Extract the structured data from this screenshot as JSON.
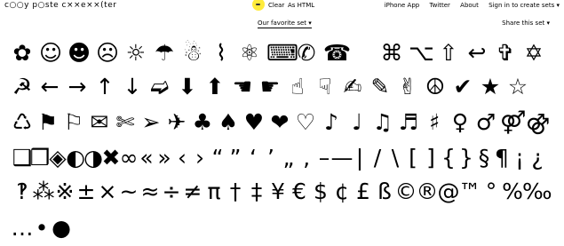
{
  "topbar": {
    "logo_text": "c○○y  p○ste c××e××(ter",
    "clear_label": "Clear",
    "as_html_label": "As HTML",
    "nav": [
      "iPhone App",
      "Twitter",
      "About",
      "Sign in to create sets ▾"
    ]
  },
  "setbar": {
    "favorite_set_label": "Our favorite set ▾",
    "share_label": "Share this set ▾"
  },
  "glyph_rows": [
    [
      "✿",
      "☺",
      "☻",
      "☹",
      "☼",
      "☂",
      "☃",
      "⌇",
      "⚛",
      "⌨",
      "✆",
      "☎",
      "",
      "⌘",
      "⌥",
      "⇧",
      "↩",
      "✞",
      "✡"
    ],
    [
      "☭",
      "←",
      "→",
      "↑",
      "↓",
      "➫",
      "⬇",
      "⬆",
      "☚",
      "☛",
      "☝",
      "☟",
      "✍",
      "✎",
      "✌",
      "☮",
      "✔",
      "★",
      "☆"
    ],
    [
      "♺",
      "⚑",
      "⚐",
      "✉",
      "✄",
      "➢",
      "✈",
      "♣",
      "♠",
      "♥",
      "❤",
      "♡",
      "♪",
      "♩",
      "♫",
      "♬",
      "♯",
      "♀",
      "♂",
      "⚤",
      "⚣"
    ],
    [
      "❑",
      "❒",
      "◈",
      "◐",
      "◑",
      "✖",
      "∞",
      "«",
      "»",
      "‹",
      "›",
      "“",
      "”",
      "‘",
      "’",
      "„",
      "‚",
      "–",
      "—",
      "|",
      "/",
      "\\",
      "[",
      "]",
      "{",
      "}",
      "§",
      "¶",
      "¡",
      "¿"
    ],
    [
      "‽",
      "⁂",
      "※",
      "±",
      "×",
      "~",
      "≈",
      "÷",
      "≠",
      "π",
      "†",
      "‡",
      "¥",
      "€",
      "$",
      "¢",
      "£",
      "ß",
      "©",
      "®",
      "@",
      "™",
      "°",
      "%",
      "‰"
    ],
    [
      "…",
      "•",
      "●"
    ]
  ]
}
